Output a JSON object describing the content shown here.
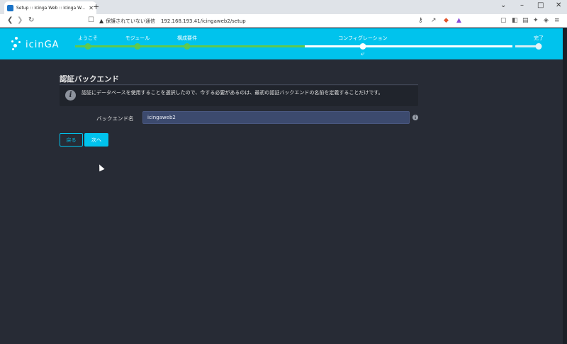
{
  "browser": {
    "tab_title": "Setup :: Icinga Web :: Icinga W...",
    "tab_close": "✕",
    "new_tab": "+",
    "window": {
      "chevron": "⌄",
      "minimize": "–",
      "maximize": "□",
      "close": "✕"
    },
    "insecure_label": "保護されていない通信",
    "url": "192.168.193.41/icingaweb2/setup"
  },
  "app": {
    "logo_text": "icinGA",
    "steps": [
      {
        "label": "ようこそ",
        "state": "done"
      },
      {
        "label": "モジュール",
        "state": "done"
      },
      {
        "label": "構成要件",
        "state": "done"
      },
      {
        "label": "コンフィグレーション",
        "state": "active"
      },
      {
        "label": "完了",
        "state": "pending"
      }
    ]
  },
  "main": {
    "title": "認証バックエンド",
    "info_text": "認証にデータベースを使用することを選択したので、今する必要があるのは、最初の認証バックエンドの名前を定義することだけです。",
    "field_label": "バックエンド名",
    "field_value": "icingaweb2",
    "help_glyph": "i",
    "info_glyph": "i",
    "back_button": "戻る",
    "next_button": "次へ"
  },
  "colors": {
    "accent": "#00c3ed",
    "step_done": "#5fc94e",
    "background": "#272b35"
  }
}
